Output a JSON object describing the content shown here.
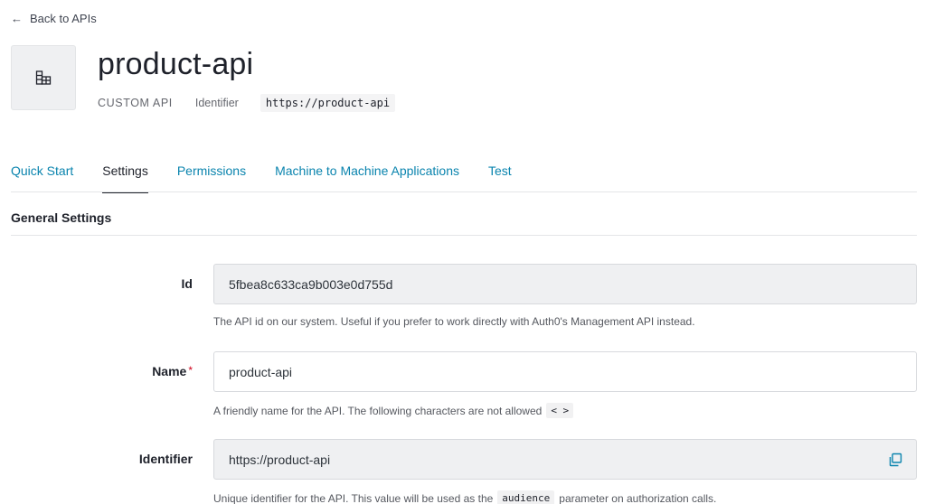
{
  "nav": {
    "back_label": "Back to APIs"
  },
  "api": {
    "name": "product-api",
    "type": "CUSTOM API",
    "identifier_label": "Identifier",
    "identifier_value": "https://product-api"
  },
  "tabs": [
    {
      "label": "Quick Start",
      "active": false
    },
    {
      "label": "Settings",
      "active": true
    },
    {
      "label": "Permissions",
      "active": false
    },
    {
      "label": "Machine to Machine Applications",
      "active": false
    },
    {
      "label": "Test",
      "active": false
    }
  ],
  "general": {
    "title": "General Settings",
    "id_field": {
      "label": "Id",
      "value": "5fbea8c633ca9b003e0d755d",
      "help": "The API id on our system. Useful if you prefer to work directly with Auth0's Management API instead."
    },
    "name_field": {
      "label": "Name",
      "required_mark": "*",
      "value": "product-api",
      "help": "A friendly name for the API. The following characters are not allowed",
      "help_code": "< >"
    },
    "identifier_field": {
      "label": "Identifier",
      "value": "https://product-api",
      "help_prefix": "Unique identifier for the API. This value will be used as the",
      "help_code": "audience",
      "help_suffix": "parameter on authorization calls."
    }
  },
  "colors": {
    "link": "#0a84ae",
    "text": "#1e212a",
    "readonly_bg": "#eff0f2",
    "required": "#d0021b"
  },
  "icons": [
    "arrow-left-icon",
    "api-building-icon",
    "copy-icon"
  ]
}
